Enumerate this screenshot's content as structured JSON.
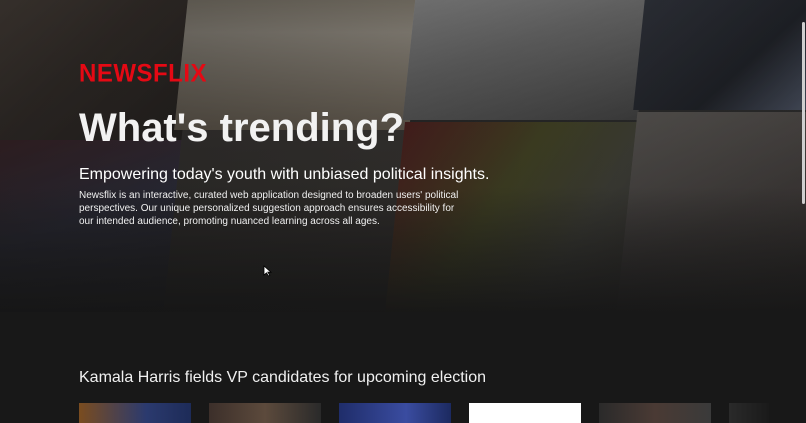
{
  "brand": {
    "name": "NEWSFLIX",
    "color": "#e50914"
  },
  "hero": {
    "title": "What's trending?",
    "subtitle": "Empowering today's youth with unbiased political insights.",
    "description": "Newsflix is an interactive, curated web application designed to broaden users' political perspectives. Our unique personalized suggestion approach ensures accessibility for our intended audience, promoting nuanced learning across all ages."
  },
  "section": {
    "title": "Kamala Harris fields VP candidates for upcoming election",
    "cards": [
      {
        "name": "news-card-1"
      },
      {
        "name": "news-card-2"
      },
      {
        "name": "news-card-3"
      },
      {
        "name": "news-card-4"
      },
      {
        "name": "news-card-5"
      },
      {
        "name": "news-card-6"
      }
    ]
  },
  "icons": {
    "cursor": "cursor-arrow-icon"
  },
  "colors": {
    "background": "#181818",
    "text": "#ffffff"
  }
}
